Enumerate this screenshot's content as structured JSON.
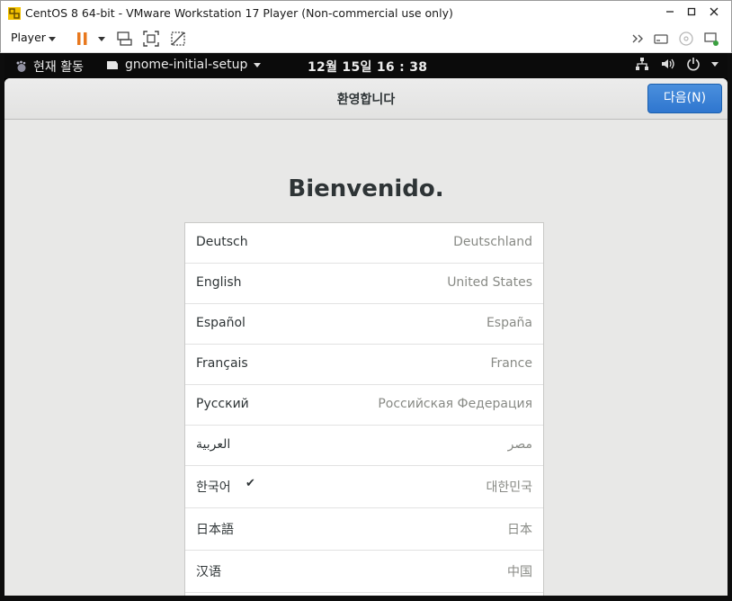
{
  "vmware": {
    "window_title": "CentOS 8 64-bit - VMware Workstation 17 Player (Non-commercial use only)",
    "player_menu_label": "Player"
  },
  "gnome": {
    "activities_label": "현재 활동",
    "app_menu_label": "gnome-initial-setup",
    "clock": "12월 15일  16 : 38"
  },
  "setup": {
    "header_title": "환영합니다",
    "next_button": "다음(N)",
    "welcome_heading": "Bienvenido.",
    "languages": [
      {
        "name": "Deutsch",
        "region": "Deutschland",
        "selected": false
      },
      {
        "name": "English",
        "region": "United States",
        "selected": false
      },
      {
        "name": "Español",
        "region": "España",
        "selected": false
      },
      {
        "name": "Français",
        "region": "France",
        "selected": false
      },
      {
        "name": "Русский",
        "region": "Российская Федерация",
        "selected": false
      },
      {
        "name": "العربية",
        "region": "مصر",
        "selected": false
      },
      {
        "name": "한국어",
        "region": "대한민국",
        "selected": true,
        "check": "✔"
      },
      {
        "name": "日本語",
        "region": "日本",
        "selected": false
      },
      {
        "name": "汉语",
        "region": "中国",
        "selected": false
      }
    ]
  },
  "colors": {
    "accent_blue": "#3379d3",
    "pause_orange": "#e8781e"
  }
}
